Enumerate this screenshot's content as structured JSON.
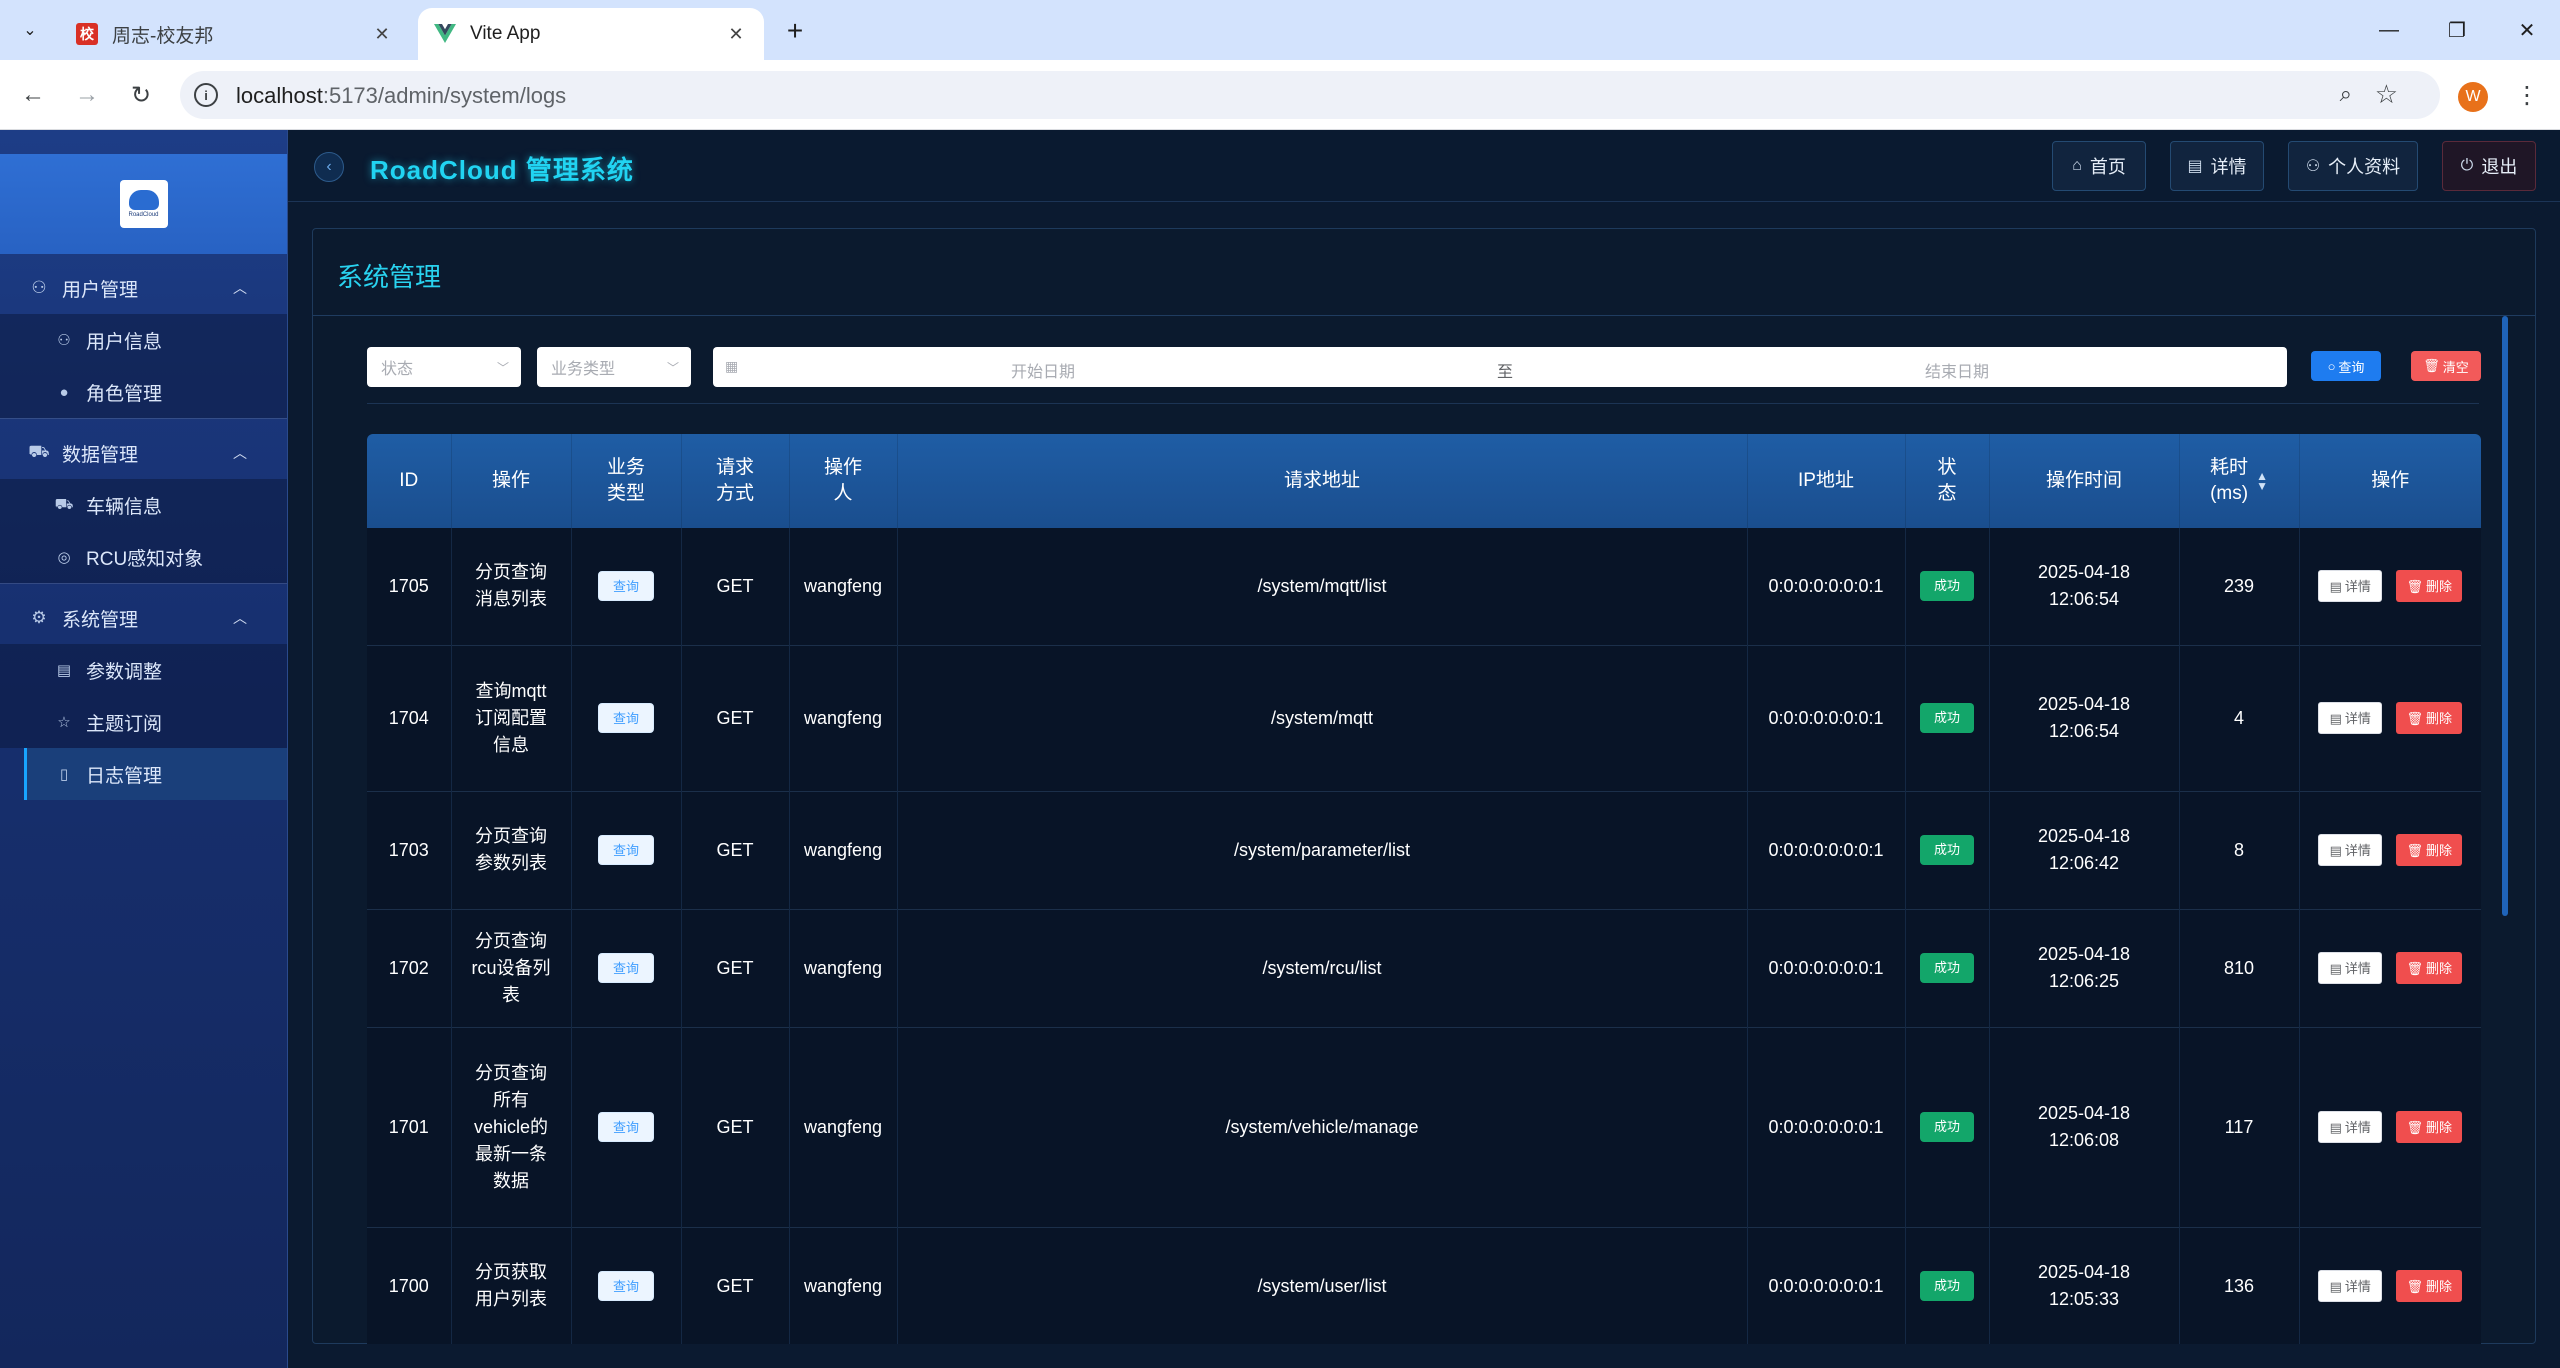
{
  "browser": {
    "tabs": [
      {
        "title": "周志-校友邦",
        "favicon": "校",
        "active": false
      },
      {
        "title": "Vite App",
        "favicon": "vue-logo",
        "active": true
      }
    ],
    "url_host": "localhost",
    "url_rest": ":5173/admin/system/logs",
    "profile_initial": "W"
  },
  "app": {
    "title": "RoadCloud 管理系统",
    "logo_text": "RoadCloud",
    "top_buttons": {
      "home": "首页",
      "detail": "详情",
      "profile": "个人资料",
      "logout": "退出"
    }
  },
  "sidebar": {
    "groups": [
      {
        "label": "用户管理",
        "icon": "user-icon",
        "items": [
          {
            "label": "用户信息",
            "icon": "user-icon"
          },
          {
            "label": "角色管理",
            "icon": "user-filled-icon"
          }
        ]
      },
      {
        "label": "数据管理",
        "icon": "cart-icon",
        "items": [
          {
            "label": "车辆信息",
            "icon": "truck-icon"
          },
          {
            "label": "RCU感知对象",
            "icon": "aim-icon"
          }
        ]
      },
      {
        "label": "系统管理",
        "icon": "gear-icon",
        "items": [
          {
            "label": "参数调整",
            "icon": "setting-doc-icon"
          },
          {
            "label": "主题订阅",
            "icon": "star-icon"
          },
          {
            "label": "日志管理",
            "icon": "document-icon"
          }
        ]
      }
    ],
    "active_item": "日志管理"
  },
  "page": {
    "title": "系统管理",
    "filters": {
      "status_placeholder": "状态",
      "type_placeholder": "业务类型",
      "start_placeholder": "开始日期",
      "range_sep": "至",
      "end_placeholder": "结束日期",
      "query_label": "查询",
      "clear_label": "清空"
    }
  },
  "table": {
    "headers": {
      "id": "ID",
      "op": "操作",
      "type_l1": "业务",
      "type_l2": "类型",
      "method_l1": "请求",
      "method_l2": "方式",
      "user_l1": "操作",
      "user_l2": "人",
      "url": "请求地址",
      "ip": "IP地址",
      "status_l1": "状",
      "status_l2": "态",
      "time": "操作时间",
      "cost_l1": "耗时",
      "cost_l2": "(ms)",
      "actions": "操作"
    },
    "detail_label": "详情",
    "delete_label": "删除",
    "rows": [
      {
        "id": "1705",
        "op": "分页查询消息列表",
        "type": "查询",
        "method": "GET",
        "user": "wangfeng",
        "url": "/system/mqtt/list",
        "ip": "0:0:0:0:0:0:0:1",
        "status": "成功",
        "date": "2025-04-18",
        "time": "12:06:54",
        "cost": "239"
      },
      {
        "id": "1704",
        "op": "查询mqtt订阅配置信息",
        "type": "查询",
        "method": "GET",
        "user": "wangfeng",
        "url": "/system/mqtt",
        "ip": "0:0:0:0:0:0:0:1",
        "status": "成功",
        "date": "2025-04-18",
        "time": "12:06:54",
        "cost": "4"
      },
      {
        "id": "1703",
        "op": "分页查询参数列表",
        "type": "查询",
        "method": "GET",
        "user": "wangfeng",
        "url": "/system/parameter/list",
        "ip": "0:0:0:0:0:0:0:1",
        "status": "成功",
        "date": "2025-04-18",
        "time": "12:06:42",
        "cost": "8"
      },
      {
        "id": "1702",
        "op": "分页查询rcu设备列表",
        "type": "查询",
        "method": "GET",
        "user": "wangfeng",
        "url": "/system/rcu/list",
        "ip": "0:0:0:0:0:0:0:1",
        "status": "成功",
        "date": "2025-04-18",
        "time": "12:06:25",
        "cost": "810"
      },
      {
        "id": "1701",
        "op": "分页查询所有vehicle的最新一条数据",
        "type": "查询",
        "method": "GET",
        "user": "wangfeng",
        "url": "/system/vehicle/manage",
        "ip": "0:0:0:0:0:0:0:1",
        "status": "成功",
        "date": "2025-04-18",
        "time": "12:06:08",
        "cost": "117"
      },
      {
        "id": "1700",
        "op": "分页获取用户列表",
        "type": "查询",
        "method": "GET",
        "user": "wangfeng",
        "url": "/system/user/list",
        "ip": "0:0:0:0:0:0:0:1",
        "status": "成功",
        "date": "2025-04-18",
        "time": "12:05:33",
        "cost": "136"
      }
    ]
  }
}
